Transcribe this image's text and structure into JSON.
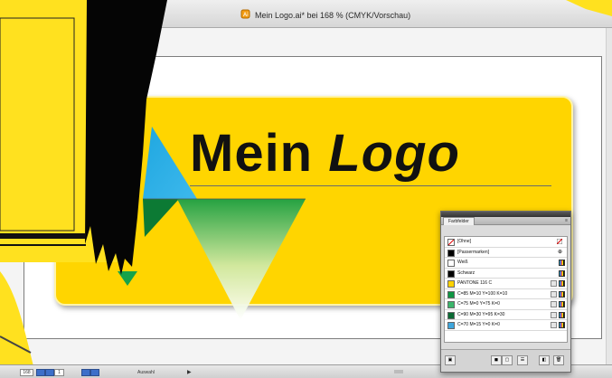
{
  "window": {
    "title": "Mein Logo.ai* bei 168 % (CMYK/Vorschau)"
  },
  "logo": {
    "word1": "Mein",
    "word2": "Logo",
    "brand_yellow": "#ffd500",
    "blue": "#29abe2",
    "green": "#16a34a"
  },
  "swatches_panel": {
    "tab_label": "Farbfelder",
    "menu_icon": "panel-menu-icon",
    "items": [
      {
        "name": "[Ohne]",
        "color": "none"
      },
      {
        "name": "[Passermarken]",
        "color": "#000000"
      },
      {
        "name": "Weiß",
        "color": "#ffffff"
      },
      {
        "name": "Schwarz",
        "color": "#000000"
      },
      {
        "name": "PANTONE 116 C",
        "color": "#ffd200"
      },
      {
        "name": "C=85 M=10 Y=100 K=10",
        "color": "#0e9642"
      },
      {
        "name": "C=75 M=0 Y=75 K=0",
        "color": "#3ab56a"
      },
      {
        "name": "C=90 M=30 Y=95 K=30",
        "color": "#0a6a33"
      },
      {
        "name": "C=70 M=15 Y=0 K=0",
        "color": "#3ea6dc"
      }
    ],
    "footer_icons": [
      "library-icon",
      "swatch-kind-icon",
      "group-icon",
      "swatch-options-icon",
      "new-swatch-icon",
      "delete-icon"
    ]
  },
  "status": {
    "zoom": "168",
    "page": "1",
    "label": "Auswahl"
  }
}
